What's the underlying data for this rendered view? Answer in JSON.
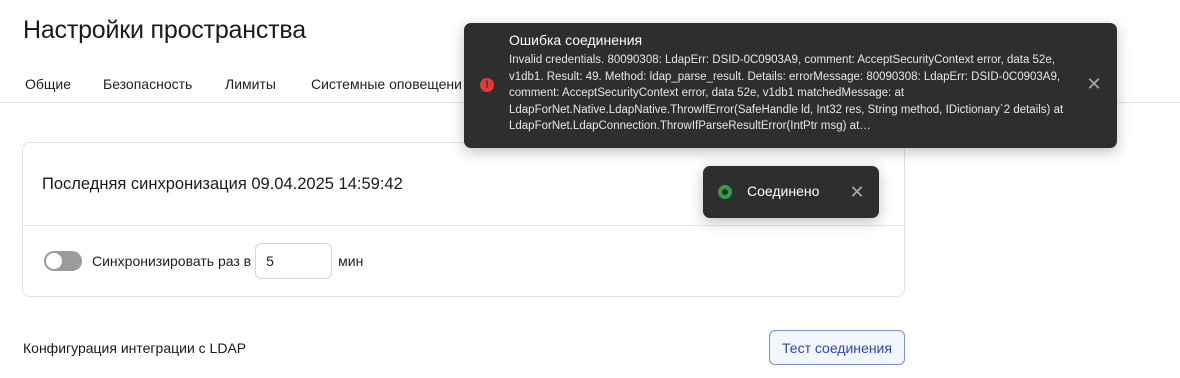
{
  "page": {
    "title": "Настройки пространства"
  },
  "tabs": [
    {
      "label": "Общие"
    },
    {
      "label": "Безопасность"
    },
    {
      "label": "Лимиты"
    },
    {
      "label": "Системные оповещени"
    }
  ],
  "sync_card": {
    "last_sync": "Последняя синхронизация 09.04.2025 14:59:42",
    "toggle_on": false,
    "sync_label": "Синхронизировать раз в",
    "interval_value": "5",
    "unit": "мин"
  },
  "ldap": {
    "title": "Конфигурация интеграции с LDAP",
    "test_button": "Тест соединения"
  },
  "toast_error": {
    "title": "Ошибка соединения",
    "message": "Invalid credentials. 80090308: LdapErr: DSID-0C0903A9, comment: AcceptSecurityContext error, data 52e, v1db1. Result: 49. Method: ldap_parse_result. Details: errorMessage: 80090308: LdapErr: DSID-0C0903A9, comment: AcceptSecurityContext error, data 52e, v1db1 matchedMessage: at LdapForNet.Native.LdapNative.ThrowIfError(SafeHandle ld, Int32 res, String method, IDictionary`2 details) at LdapForNet.LdapConnection.ThrowIfParseResultError(IntPtr msg) at…",
    "icon": "error-icon",
    "icon_symbol": "!",
    "close_symbol": "✕"
  },
  "toast_success": {
    "text": "Соединено",
    "icon": "success-icon",
    "close_symbol": "✕"
  },
  "colors": {
    "accent": "#2c46b0",
    "error": "#e53935",
    "success": "#2e9e44",
    "toast_bg": "#2e2e2e"
  }
}
